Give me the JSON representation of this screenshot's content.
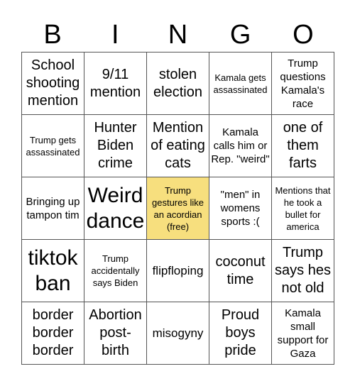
{
  "header": {
    "letters": [
      "B",
      "I",
      "N",
      "G",
      "O"
    ]
  },
  "colors": {
    "free_cell": "#f7df7e",
    "grid_line": "#555555"
  },
  "cells": [
    {
      "text": "School shooting mention",
      "size": "s4"
    },
    {
      "text": "9/11 mention",
      "size": "s4"
    },
    {
      "text": "stolen election",
      "size": "s4"
    },
    {
      "text": "Kamala gets assassinated",
      "size": "s1"
    },
    {
      "text": "Trump questions Kamala's race",
      "size": "s2"
    },
    {
      "text": "Trump gets assassinated",
      "size": "s1"
    },
    {
      "text": "Hunter Biden crime",
      "size": "s4"
    },
    {
      "text": "Mention of eating cats",
      "size": "s4"
    },
    {
      "text": "Kamala calls him or Rep. \"weird\"",
      "size": "s2"
    },
    {
      "text": "one of them farts",
      "size": "s4"
    },
    {
      "text": "Bringing up tampon tim",
      "size": "s2"
    },
    {
      "text": "Weird dance",
      "size": "s5"
    },
    {
      "text": "Trump gestures like an acordian (free)",
      "size": "s1",
      "free": true
    },
    {
      "text": "\"men\" in womens sports :(",
      "size": "s2"
    },
    {
      "text": "Mentions that he took a bullet for america",
      "size": "s1"
    },
    {
      "text": "tiktok ban",
      "size": "s5"
    },
    {
      "text": "Trump accidentally says Biden",
      "size": "s1"
    },
    {
      "text": "flipfloping",
      "size": "s3"
    },
    {
      "text": "coconut time",
      "size": "s4"
    },
    {
      "text": "Trump says hes not old",
      "size": "s4"
    },
    {
      "text": "border border border",
      "size": "s4"
    },
    {
      "text": "Abortion post-birth",
      "size": "s4"
    },
    {
      "text": "misogyny",
      "size": "s3"
    },
    {
      "text": "Proud boys pride",
      "size": "s4"
    },
    {
      "text": "Kamala small support for Gaza",
      "size": "s2"
    }
  ]
}
